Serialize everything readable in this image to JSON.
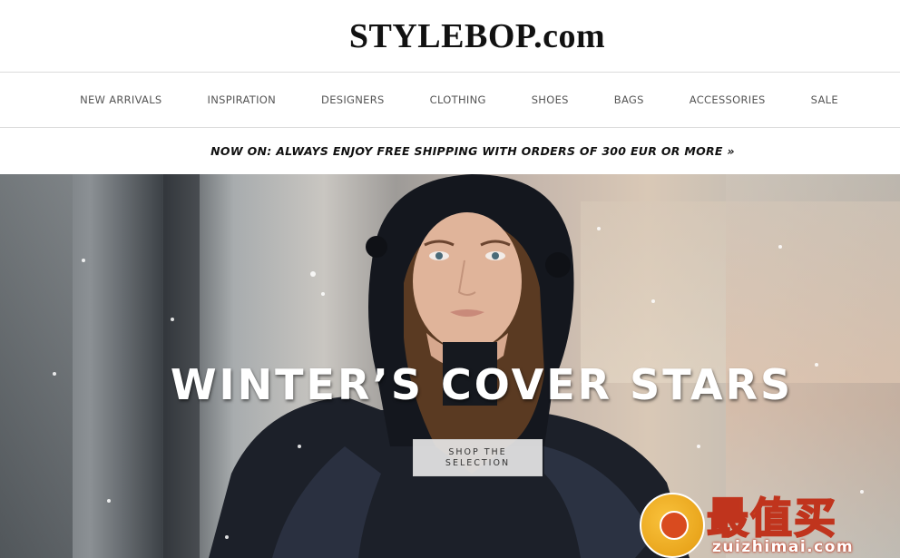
{
  "header": {
    "logo": "STYLEBOP.com"
  },
  "nav": {
    "items": [
      {
        "label": "NEW ARRIVALS"
      },
      {
        "label": "INSPIRATION"
      },
      {
        "label": "DESIGNERS"
      },
      {
        "label": "CLOTHING"
      },
      {
        "label": "SHOES"
      },
      {
        "label": "BAGS"
      },
      {
        "label": "ACCESSORIES"
      },
      {
        "label": "SALE"
      }
    ]
  },
  "promo": {
    "text": "NOW ON: ALWAYS ENJOY FREE SHIPPING WITH ORDERS OF 300 EUR OR MORE »"
  },
  "hero": {
    "title": "WINTER’S COVER STARS",
    "button_line1": "SHOP THE",
    "button_line2": "SELECTION"
  },
  "watermark": {
    "chars": "最值买",
    "url": "zuizhimai.com"
  },
  "colors": {
    "text": "#222222",
    "nav_text": "#555555",
    "divider": "#dcdcdc",
    "button_bg": "#e6e6e6"
  }
}
